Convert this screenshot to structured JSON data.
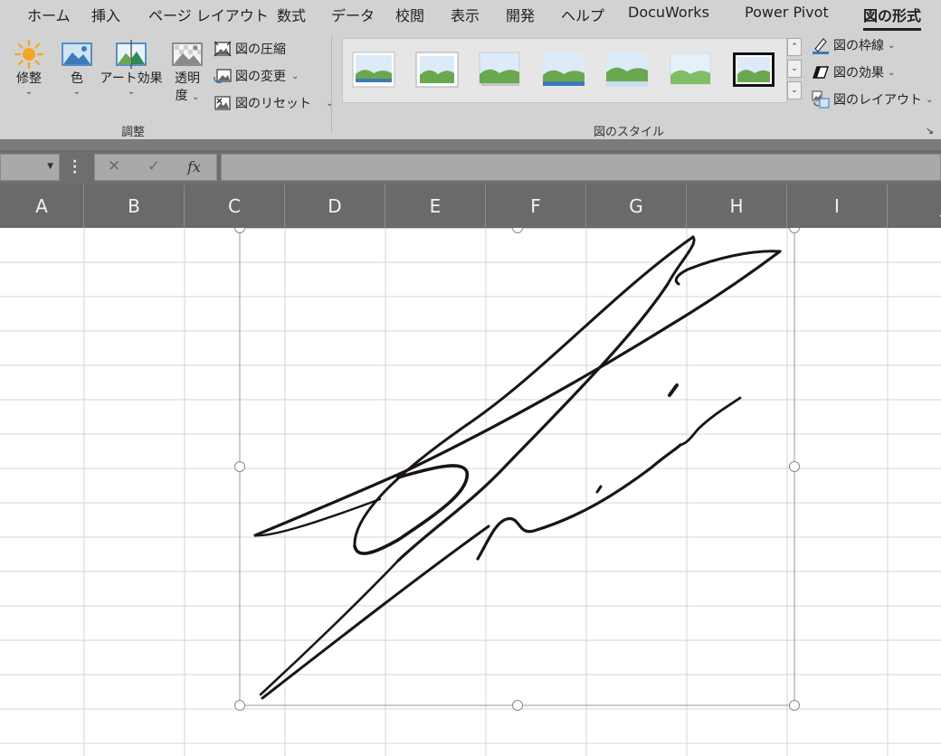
{
  "tabs": [
    {
      "label": "ホーム"
    },
    {
      "label": "挿入"
    },
    {
      "label": "ページ レイアウト"
    },
    {
      "label": "数式"
    },
    {
      "label": "データ"
    },
    {
      "label": "校閲"
    },
    {
      "label": "表示"
    },
    {
      "label": "開発"
    },
    {
      "label": "ヘルプ"
    },
    {
      "label": "DocuWorks"
    },
    {
      "label": "Power Pivot"
    },
    {
      "label": "図の形式"
    }
  ],
  "active_tab": "図の形式",
  "ribbon": {
    "adjust": {
      "corrections": "修整",
      "color": "色",
      "artistic_effects": "アート効果",
      "transparency_1": "透明",
      "transparency_2": "度",
      "compress": "図の圧縮",
      "change_picture": "図の変更",
      "reset_picture": "図のリセット",
      "group_label": "調整"
    },
    "styles": {
      "group_label": "図のスタイル",
      "border": "図の枠線",
      "effects": "図の効果",
      "layout": "図のレイアウト"
    }
  },
  "formula_bar": {
    "cancel_symbol": "✕",
    "enter_symbol": "✓",
    "fx_symbol": "fx",
    "value": ""
  },
  "columns": [
    "A",
    "B",
    "C",
    "D",
    "E",
    "F",
    "G",
    "H",
    "I",
    "J"
  ],
  "colors": {
    "ribbon_bg": "#d2d2d2",
    "header_bg": "#6a6a6a",
    "grid_line": "#d4d4d4",
    "ink": "#1a1414"
  }
}
